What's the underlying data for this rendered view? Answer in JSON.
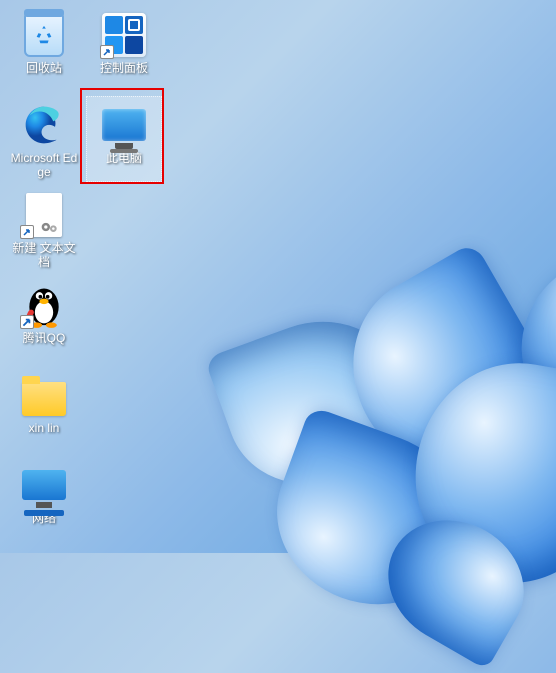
{
  "icons": {
    "recycle_bin": {
      "label": "回收站"
    },
    "control_panel": {
      "label": "控制面板"
    },
    "edge": {
      "label": "Microsoft Edge"
    },
    "this_pc": {
      "label": "此电脑"
    },
    "new_text": {
      "label": "新建 文本文档"
    },
    "qq": {
      "label": "腾讯QQ"
    },
    "xinlin": {
      "label": "xin lin"
    },
    "network": {
      "label": "网络"
    }
  },
  "selection": {
    "selected_icon": "this_pc",
    "highlight_color": "#e60000"
  }
}
